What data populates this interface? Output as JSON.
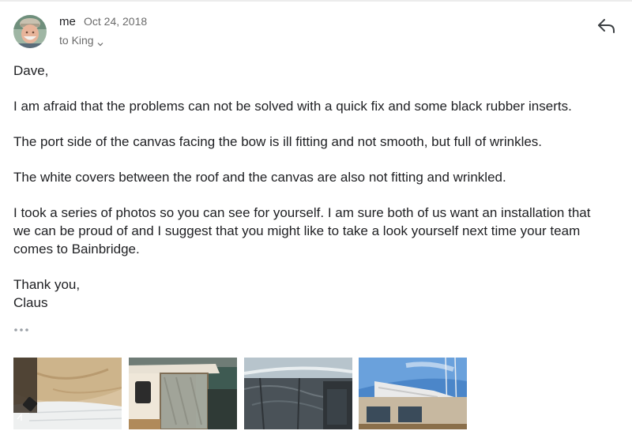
{
  "header": {
    "sender": "me",
    "date": "Oct 24, 2018",
    "recipient": "to King",
    "icons": {
      "avatar": "avatar",
      "reply": "reply-icon",
      "recipient_toggle": "chevron-down-icon",
      "more": "ellipsis-icon"
    }
  },
  "message": {
    "greeting": "Dave,",
    "paragraph1": "I am afraid that the problems can not be solved with a quick fix and some black rubber inserts.",
    "paragraph2": "The port side of the canvas facing the bow is ill fitting and not smooth, but full of wrinkles.",
    "paragraph3": "The white covers between the roof and the canvas are also not fitting and wrinkled.",
    "paragraph4_lines": [
      "I took a series of photos so you can see for yourself. I am sure both of us want an installation that",
      "we can be proud of and I suggest that you might like to take a look yourself next time your team",
      "comes to Bainbridge."
    ],
    "closing": "Thank you,",
    "signature": "Claus"
  },
  "attachments": [
    {
      "name": "attachment-photo-1"
    },
    {
      "name": "attachment-photo-2"
    },
    {
      "name": "attachment-photo-3"
    },
    {
      "name": "attachment-photo-4"
    }
  ],
  "colors": {
    "text": "#202124",
    "secondary": "#6b6b6b"
  }
}
